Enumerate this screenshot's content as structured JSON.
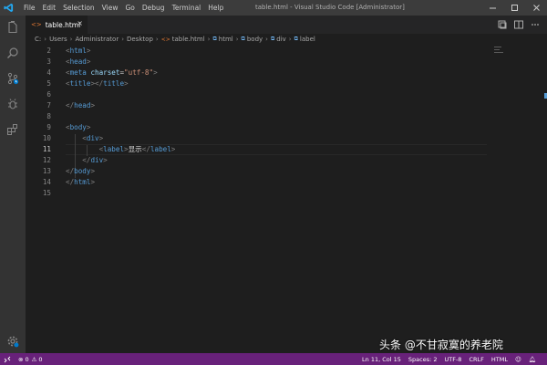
{
  "titlebar": {
    "menu": [
      "File",
      "Edit",
      "Selection",
      "View",
      "Go",
      "Debug",
      "Terminal",
      "Help"
    ],
    "window_title": "table.html - Visual Studio Code [Administrator]"
  },
  "tab": {
    "label": "table.html",
    "close": "×"
  },
  "breadcrumb": [
    "C:",
    "Users",
    "Administrator",
    "Desktop",
    "table.html",
    "html",
    "body",
    "div",
    "label"
  ],
  "editor": {
    "active_line": 11,
    "lines": [
      {
        "n": "2",
        "parts": [
          [
            "pn",
            "<"
          ],
          [
            "tg",
            "html"
          ],
          [
            "pn",
            ">"
          ]
        ]
      },
      {
        "n": "3",
        "parts": [
          [
            "pn",
            "<"
          ],
          [
            "tg",
            "head"
          ],
          [
            "pn",
            ">"
          ]
        ]
      },
      {
        "n": "4",
        "parts": [
          [
            "pn",
            "<"
          ],
          [
            "tg",
            "meta"
          ],
          [
            "tx",
            " "
          ],
          [
            "at",
            "charset"
          ],
          [
            "tx",
            "="
          ],
          [
            "st",
            "\"utf-8\""
          ],
          [
            "pn",
            ">"
          ]
        ]
      },
      {
        "n": "5",
        "parts": [
          [
            "pn",
            "<"
          ],
          [
            "tg",
            "title"
          ],
          [
            "pn",
            "></"
          ],
          [
            "tg",
            "title"
          ],
          [
            "pn",
            ">"
          ]
        ]
      },
      {
        "n": "6",
        "parts": []
      },
      {
        "n": "7",
        "parts": [
          [
            "pn",
            "</"
          ],
          [
            "tg",
            "head"
          ],
          [
            "pn",
            ">"
          ]
        ]
      },
      {
        "n": "8",
        "parts": []
      },
      {
        "n": "9",
        "parts": [
          [
            "pn",
            "<"
          ],
          [
            "tg",
            "body"
          ],
          [
            "pn",
            ">"
          ]
        ]
      },
      {
        "n": "10",
        "parts": [
          [
            "tx",
            "    "
          ],
          [
            "pn",
            "<"
          ],
          [
            "tg",
            "div"
          ],
          [
            "pn",
            ">"
          ]
        ]
      },
      {
        "n": "11",
        "parts": [
          [
            "tx",
            "        "
          ],
          [
            "pn",
            "<"
          ],
          [
            "tg",
            "label"
          ],
          [
            "pn",
            ">"
          ],
          [
            "tx",
            "显示"
          ],
          [
            "pn",
            "</"
          ],
          [
            "tg",
            "label"
          ],
          [
            "pn",
            ">"
          ]
        ]
      },
      {
        "n": "12",
        "parts": [
          [
            "tx",
            "    "
          ],
          [
            "pn",
            "</"
          ],
          [
            "tg",
            "div"
          ],
          [
            "pn",
            ">"
          ]
        ]
      },
      {
        "n": "13",
        "parts": [
          [
            "pn",
            "</"
          ],
          [
            "tg",
            "body"
          ],
          [
            "pn",
            ">"
          ]
        ]
      },
      {
        "n": "14",
        "parts": [
          [
            "pn",
            "</"
          ],
          [
            "tg",
            "html"
          ],
          [
            "pn",
            ">"
          ]
        ]
      },
      {
        "n": "15",
        "parts": []
      }
    ]
  },
  "statusbar": {
    "errors": "0",
    "warnings": "0",
    "position": "Ln 11, Col 15",
    "spaces": "Spaces: 2",
    "encoding": "UTF-8",
    "eol": "CRLF",
    "language": "HTML"
  },
  "watermark": "头条 @不甘寂寞的养老院",
  "colors": {
    "statusbar": "#68217a",
    "editor_bg": "#1e1e1e",
    "tag": "#569cd6",
    "attribute": "#9cdcfe",
    "string": "#ce9178"
  },
  "icons": [
    "vscode-logo-icon",
    "explorer-icon",
    "search-icon",
    "source-control-icon",
    "debug-icon",
    "extensions-icon",
    "settings-gear-icon",
    "split-editor-icon",
    "more-actions-icon"
  ]
}
